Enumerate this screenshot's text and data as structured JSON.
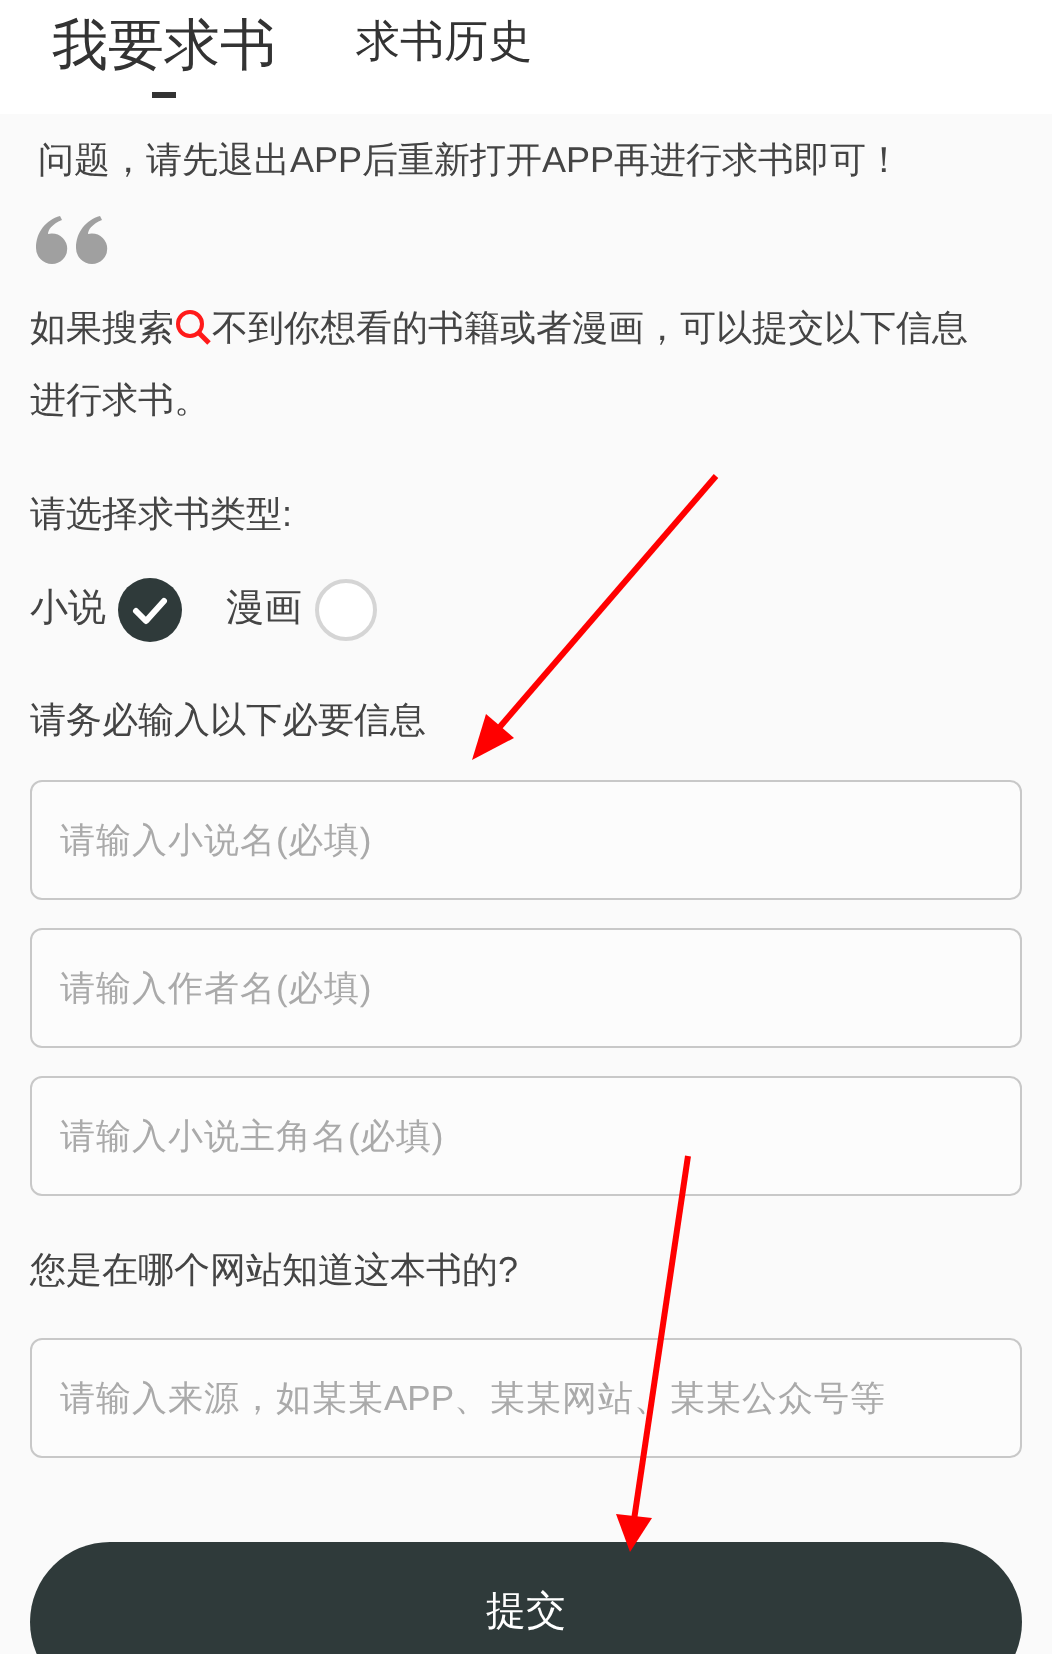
{
  "tabs": [
    {
      "label": "我要求书",
      "selected": true
    },
    {
      "label": "求书历史",
      "selected": false
    }
  ],
  "notice": "问题，请先退出APP后重新打开APP再进行求书即可！",
  "intro_before": "如果搜索",
  "intro_after": "不到你想看的书籍或者漫画，可以提交以下信息进行求书。",
  "type_prompt": "请选择求书类型:",
  "types": [
    {
      "label": "小说",
      "selected": true
    },
    {
      "label": "漫画",
      "selected": false
    }
  ],
  "required_prompt": "请务必输入以下必要信息",
  "required_fields": [
    {
      "placeholder": "请输入小说名(必填)"
    },
    {
      "placeholder": "请输入作者名(必填)"
    },
    {
      "placeholder": "请输入小说主角名(必填)"
    }
  ],
  "source_prompt": "您是在哪个网站知道这本书的?",
  "source_field": {
    "placeholder": "请输入来源，如某某APP、某某网站、某某公众号等"
  },
  "submit": "提交"
}
